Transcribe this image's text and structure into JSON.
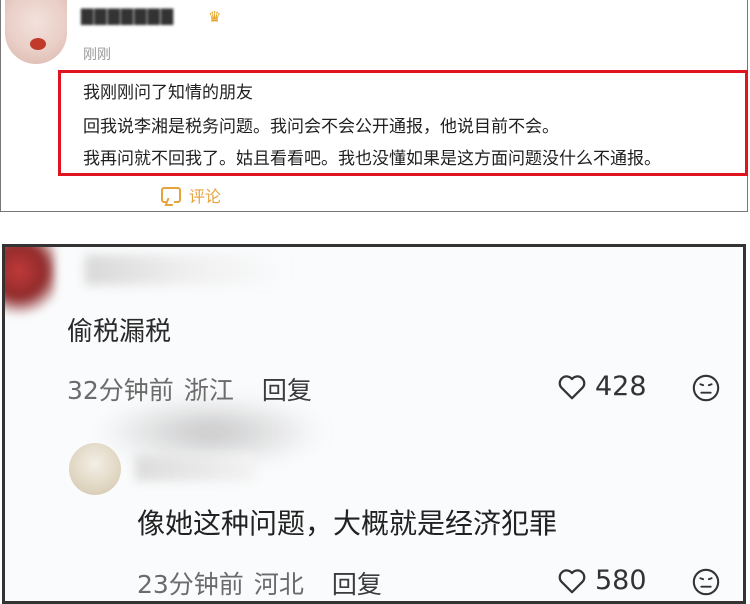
{
  "top_comment": {
    "timestamp": "刚刚",
    "quote_lines": [
      "我刚刚问了知情的朋友",
      "回我说李湘是税务问题。我问会不会公开通报，他说目前不会。",
      "我再问就不回我了。姑且看看吧。我也没懂如果是这方面问题没什么不通报。"
    ],
    "comment_label": "评论",
    "accent_color": "#e6a23c",
    "highlight_color": "#e0141e"
  },
  "comments": [
    {
      "text": "偷税漏税",
      "time": "32分钟前",
      "location": "浙江",
      "reply_label": "回复",
      "likes": "428",
      "like_icon": "heart-icon",
      "react_icon": "emoji-face-icon"
    },
    {
      "text": "像她这种问题，大概就是经济犯罪",
      "time": "23分钟前",
      "location": "河北",
      "reply_label": "回复",
      "likes": "580",
      "like_icon": "heart-icon",
      "react_icon": "emoji-face-icon"
    }
  ]
}
